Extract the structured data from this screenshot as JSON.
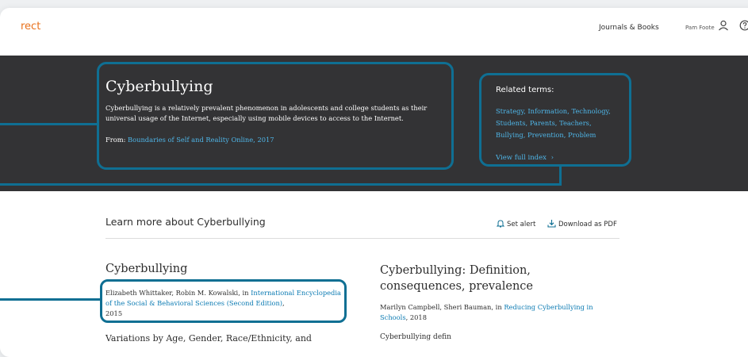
{
  "header": {
    "brand_text": "rect",
    "journals_books": "Journals & Books",
    "user_name": "Pam Foote"
  },
  "hero": {
    "title": "Cyberbullying",
    "description": "Cyberbullying is a relatively prevalent phenomenon in adolescents and college students as their universal usage of the Internet, especially using mobile devices to access to the Internet.",
    "from_label": "From:",
    "from_source": "Boundaries of Self and Reality Online, 2017",
    "related_title": "Related terms:",
    "related_terms": [
      "Strategy",
      "Information",
      "Technology",
      "Students",
      "Parents",
      "Teachers",
      "Bullying",
      "Prevention",
      "Problem"
    ],
    "view_full_index": "View full index"
  },
  "learn": {
    "heading": "Learn more about Cyberbullying",
    "set_alert": "Set alert",
    "download_pdf": "Download as PDF"
  },
  "articles": [
    {
      "title": "Cyberbullying",
      "authors": "Elizabeth Whittaker, Robin M. Kowalski, in",
      "source": "International Encyclopedia of the Social & Behavioral Sciences (Second Edition)",
      "year": "2015",
      "next_heading": "Variations by Age, Gender, Race/Ethnicity, and"
    },
    {
      "title": "Cyberbullying: Definition, consequences, prevalence",
      "authors": "Marilyn Campbell, Sheri Bauman, in",
      "source": "Reducing Cyberbullying in Schools",
      "year": "2018",
      "next_heading": "Cyberbullying defin"
    }
  ],
  "colors": {
    "brand": "#e9711c",
    "hero_bg": "#333335",
    "highlight": "#0f6f93",
    "link": "#4fb6e8"
  }
}
